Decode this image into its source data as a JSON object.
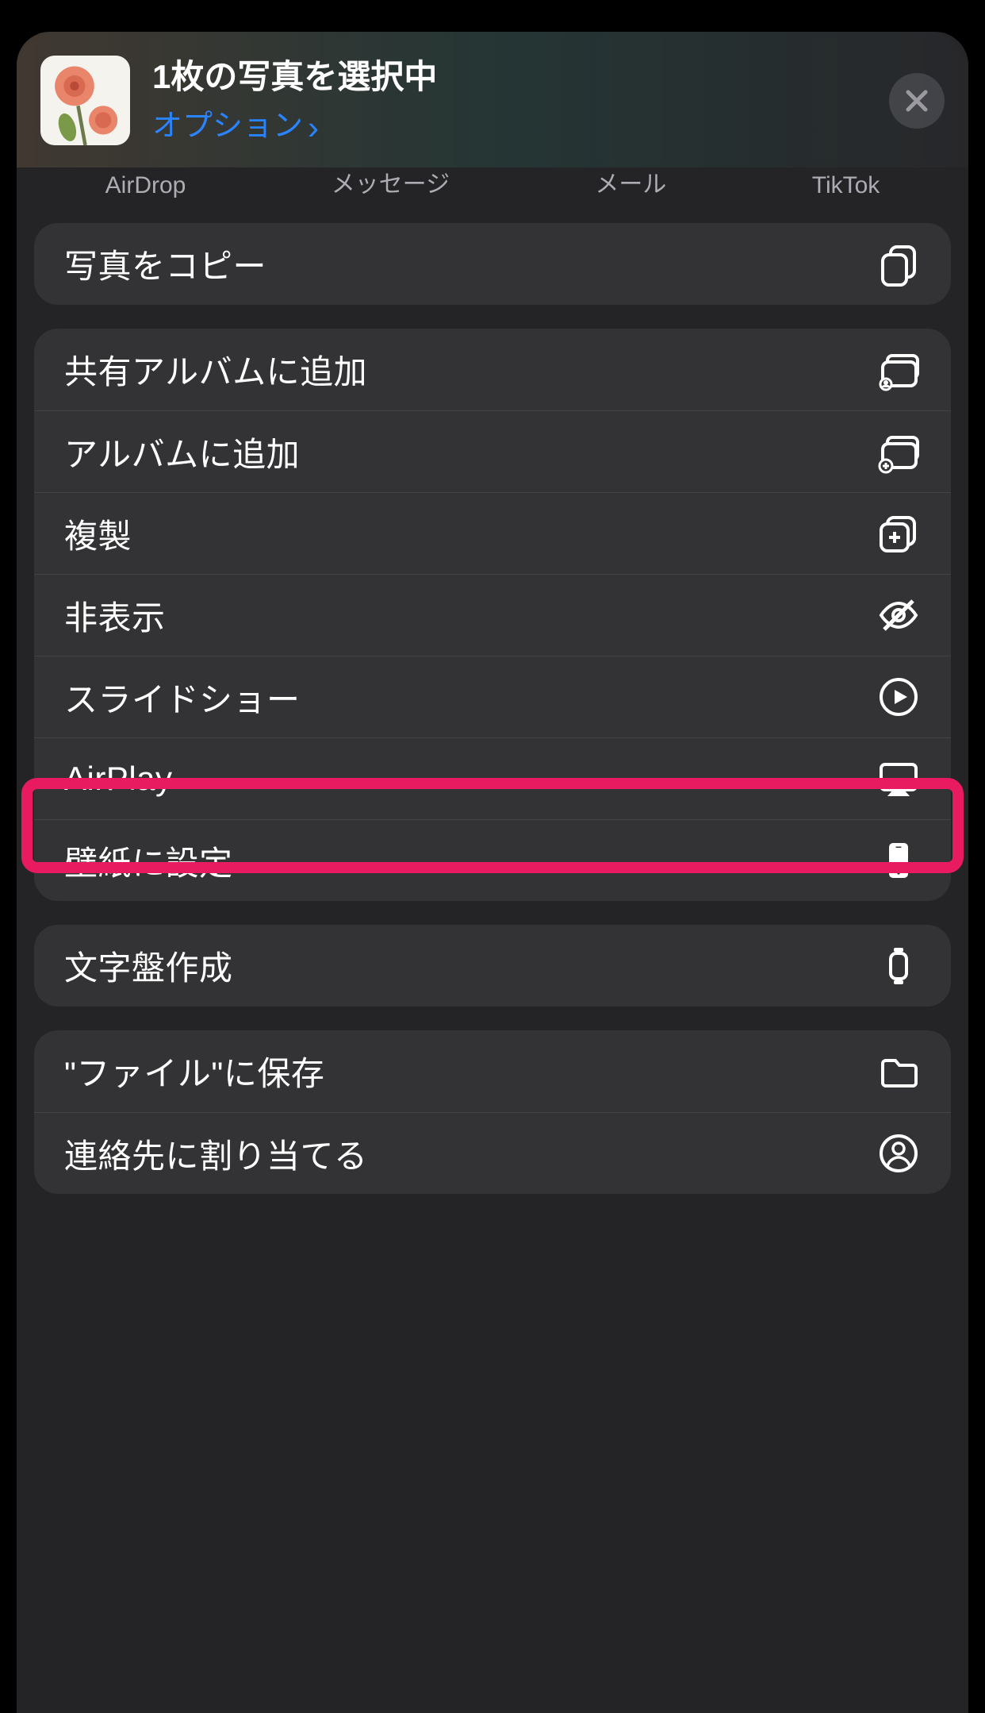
{
  "header": {
    "title": "1枚の写真を選択中",
    "options_label": "オプション"
  },
  "apps_row": [
    "AirDrop",
    "メッセージ",
    "メール",
    "TikTok"
  ],
  "groups": [
    {
      "rows": [
        {
          "label": "写真をコピー",
          "icon": "copy"
        }
      ]
    },
    {
      "rows": [
        {
          "label": "共有アルバムに追加",
          "icon": "shared-album"
        },
        {
          "label": "アルバムに追加",
          "icon": "add-album"
        },
        {
          "label": "複製",
          "icon": "duplicate"
        },
        {
          "label": "非表示",
          "icon": "eye-off"
        },
        {
          "label": "スライドショー",
          "icon": "play-circle"
        },
        {
          "label": "AirPlay",
          "icon": "airplay"
        },
        {
          "label": "壁紙に設定",
          "icon": "iphone",
          "annotation_highlight": true
        }
      ]
    },
    {
      "rows": [
        {
          "label": "文字盤作成",
          "icon": "watch"
        }
      ]
    },
    {
      "rows": [
        {
          "label": "\"ファイル\"に保存",
          "icon": "folder"
        },
        {
          "label": "連絡先に割り当てる",
          "icon": "person-circle"
        }
      ]
    }
  ],
  "colors": {
    "highlight": "#e81b60",
    "link": "#2a84ff",
    "sheet_bg": "#242426",
    "row_bg": "#333335"
  }
}
